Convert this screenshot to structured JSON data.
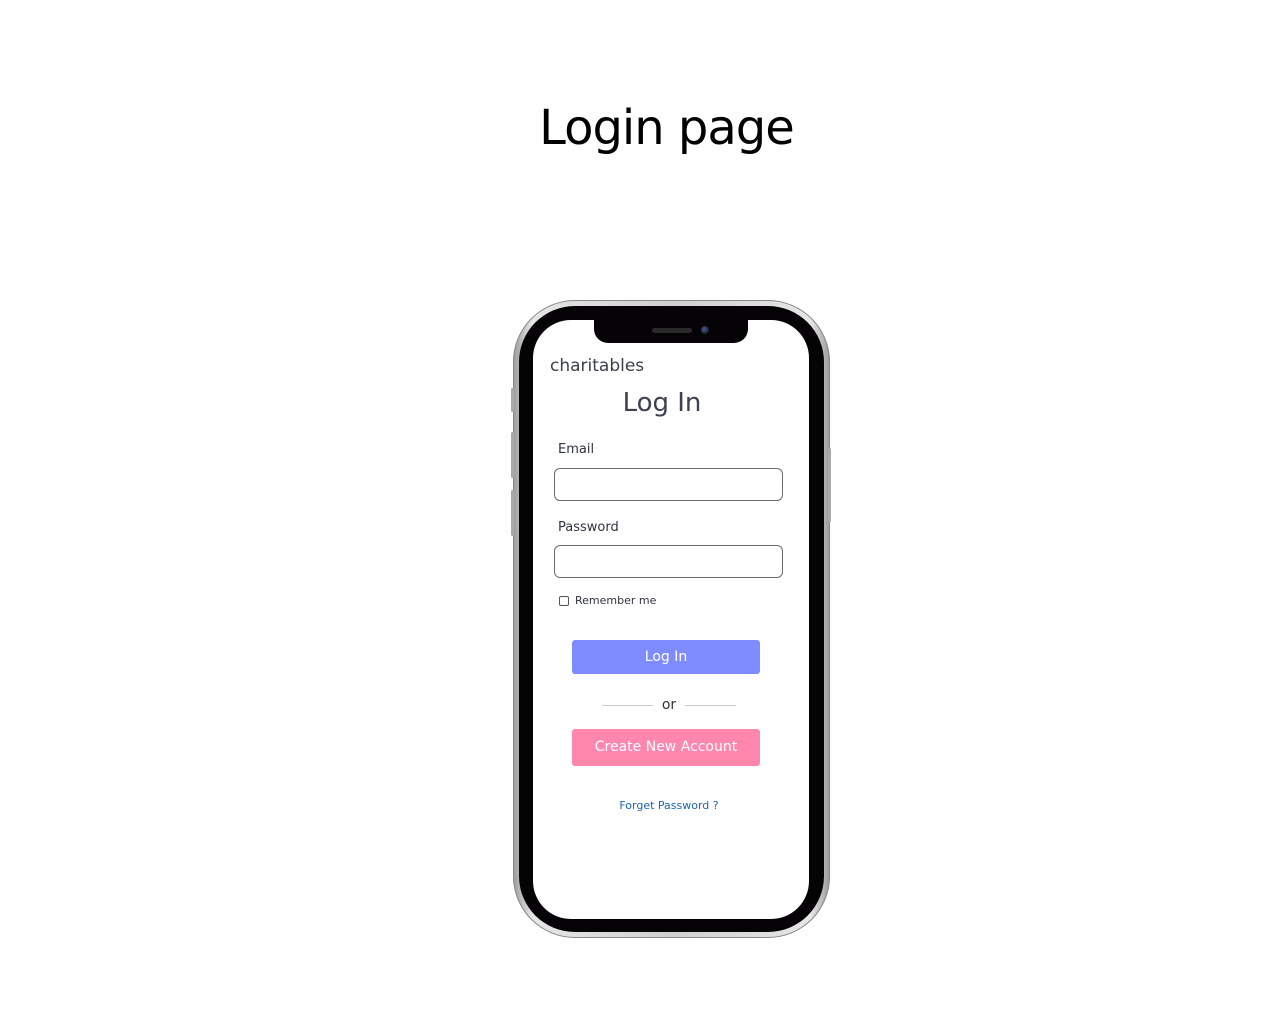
{
  "page": {
    "title": "Login page"
  },
  "app": {
    "brand": "charitables"
  },
  "form": {
    "heading": "Log In",
    "email_label": "Email",
    "email_value": "",
    "password_label": "Password",
    "password_value": "",
    "remember_label": "Remember me",
    "remember_checked": false,
    "login_button": "Log In",
    "divider_text": "or",
    "create_account_button": "Create New Account",
    "forgot_password_link": "Forget Password ?"
  },
  "colors": {
    "login_button": "#7f8cff",
    "create_button": "#ff86ad",
    "link": "#1a66b3",
    "text": "#3e4150"
  }
}
